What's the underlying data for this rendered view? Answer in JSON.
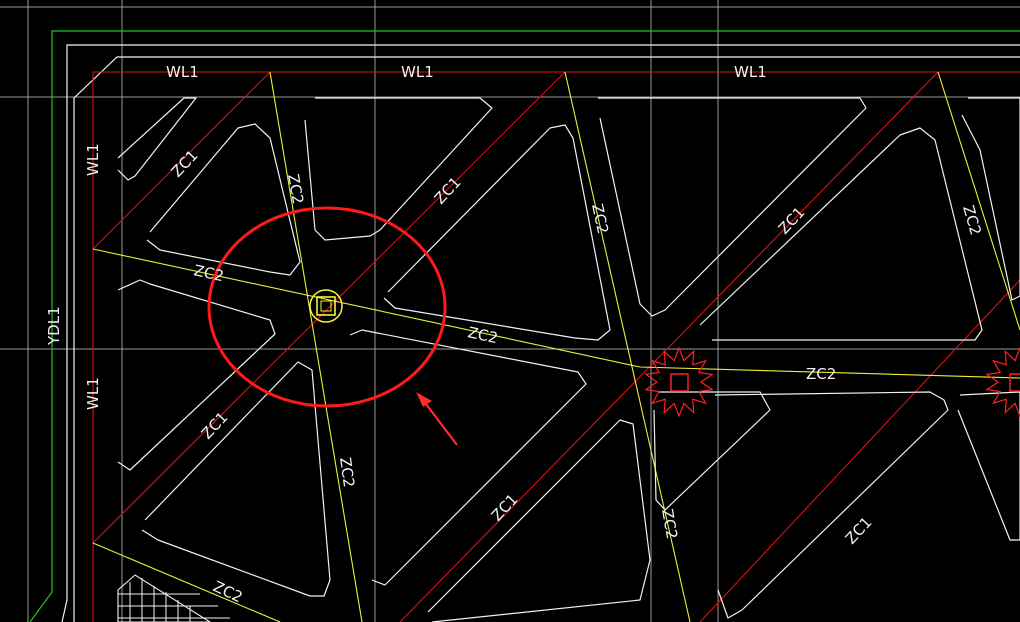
{
  "drawing": {
    "beam_labels": {
      "wl_top_1": "WL1",
      "wl_top_2": "WL1",
      "wl_top_3": "WL1",
      "wl_left_1": "WL1",
      "wl_left_2": "WL1",
      "ydl_left": "YDL1",
      "zc1_a": "ZC1",
      "zc1_b": "ZC1",
      "zc1_c": "ZC1",
      "zc1_d": "ZC1",
      "zc1_e": "ZC1",
      "zc1_f": "ZC1",
      "zc2_a": "ZC2",
      "zc2_b": "ZC2",
      "zc2_c": "ZC2",
      "zc2_d": "ZC2",
      "zc2_e": "ZC2",
      "zc2_f": "ZC2",
      "zc2_g": "ZC2",
      "zc2_h": "ZC2"
    },
    "colors": {
      "background": "#000000",
      "outline": "#ffffff",
      "gridline": "#b5b5b5",
      "axis_red": "#e01010",
      "axis_yellow": "#f0ef3a",
      "boundary_green": "#22c322",
      "highlight_circle": "#ff1a1a",
      "arrow": "#ff2a2a",
      "node_selected": "#f5f538",
      "node_error": "#ff2020"
    },
    "icons": {
      "highlight": "red-highlight-circle",
      "arrow": "red-pointer-arrow",
      "selected_node": "selected-column-node-icon",
      "error_node": "error-burst-icon"
    }
  }
}
